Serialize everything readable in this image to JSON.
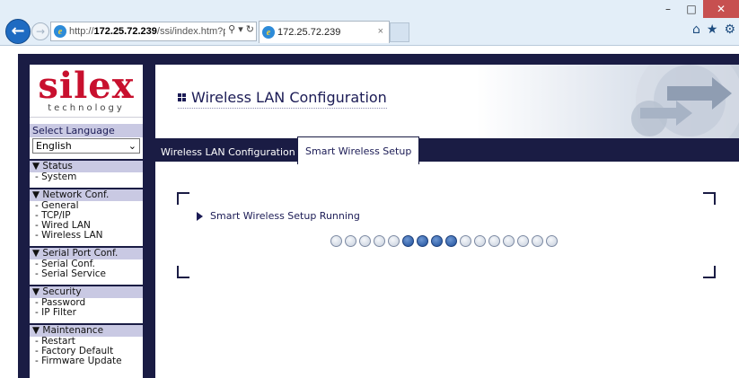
{
  "browser": {
    "window_controls": {
      "minimize": "–",
      "maximize": "□",
      "close": "✕"
    },
    "back_icon": "arrow-left-icon",
    "forward_icon": "arrow-right-icon",
    "address": {
      "prefix": "http://",
      "host": "172.25.72.239",
      "path": "/ssi/index.htm?paı",
      "tools": "⚲ ▾ ↻"
    },
    "tab": {
      "title": "172.25.72.239",
      "close": "×"
    },
    "right_icons": [
      "home-icon",
      "star-icon",
      "gear-icon"
    ],
    "right_glyphs": {
      "home": "⌂",
      "star": "★",
      "gear": "⚙"
    }
  },
  "sidebar": {
    "logo": {
      "main": "silex",
      "sub": "technology"
    },
    "language": {
      "label": "Select Language",
      "selected": "English"
    },
    "sections": [
      {
        "title": "Status",
        "items": [
          "System"
        ]
      },
      {
        "title": "Network Conf.",
        "items": [
          "General",
          "TCP/IP",
          "Wired LAN",
          "Wireless LAN"
        ]
      },
      {
        "title": "Serial Port Conf.",
        "items": [
          "Serial Conf.",
          "Serial Service"
        ]
      },
      {
        "title": "Security",
        "items": [
          "Password",
          "IP Filter"
        ]
      },
      {
        "title": "Maintenance",
        "items": [
          "Restart",
          "Factory Default",
          "Firmware Update"
        ]
      }
    ]
  },
  "main": {
    "title": "Wireless LAN Configuration",
    "tabs": [
      "Wireless LAN Configuration",
      "Smart Wireless Setup"
    ],
    "active_tab": 1,
    "status_text": "Smart Wireless Setup Running",
    "progress": {
      "total": 16,
      "active": [
        5,
        6,
        7,
        8
      ]
    }
  },
  "colors": {
    "navy": "#1a1c44",
    "brand_red": "#c8102e",
    "dot_on": "#1d4e9a"
  }
}
